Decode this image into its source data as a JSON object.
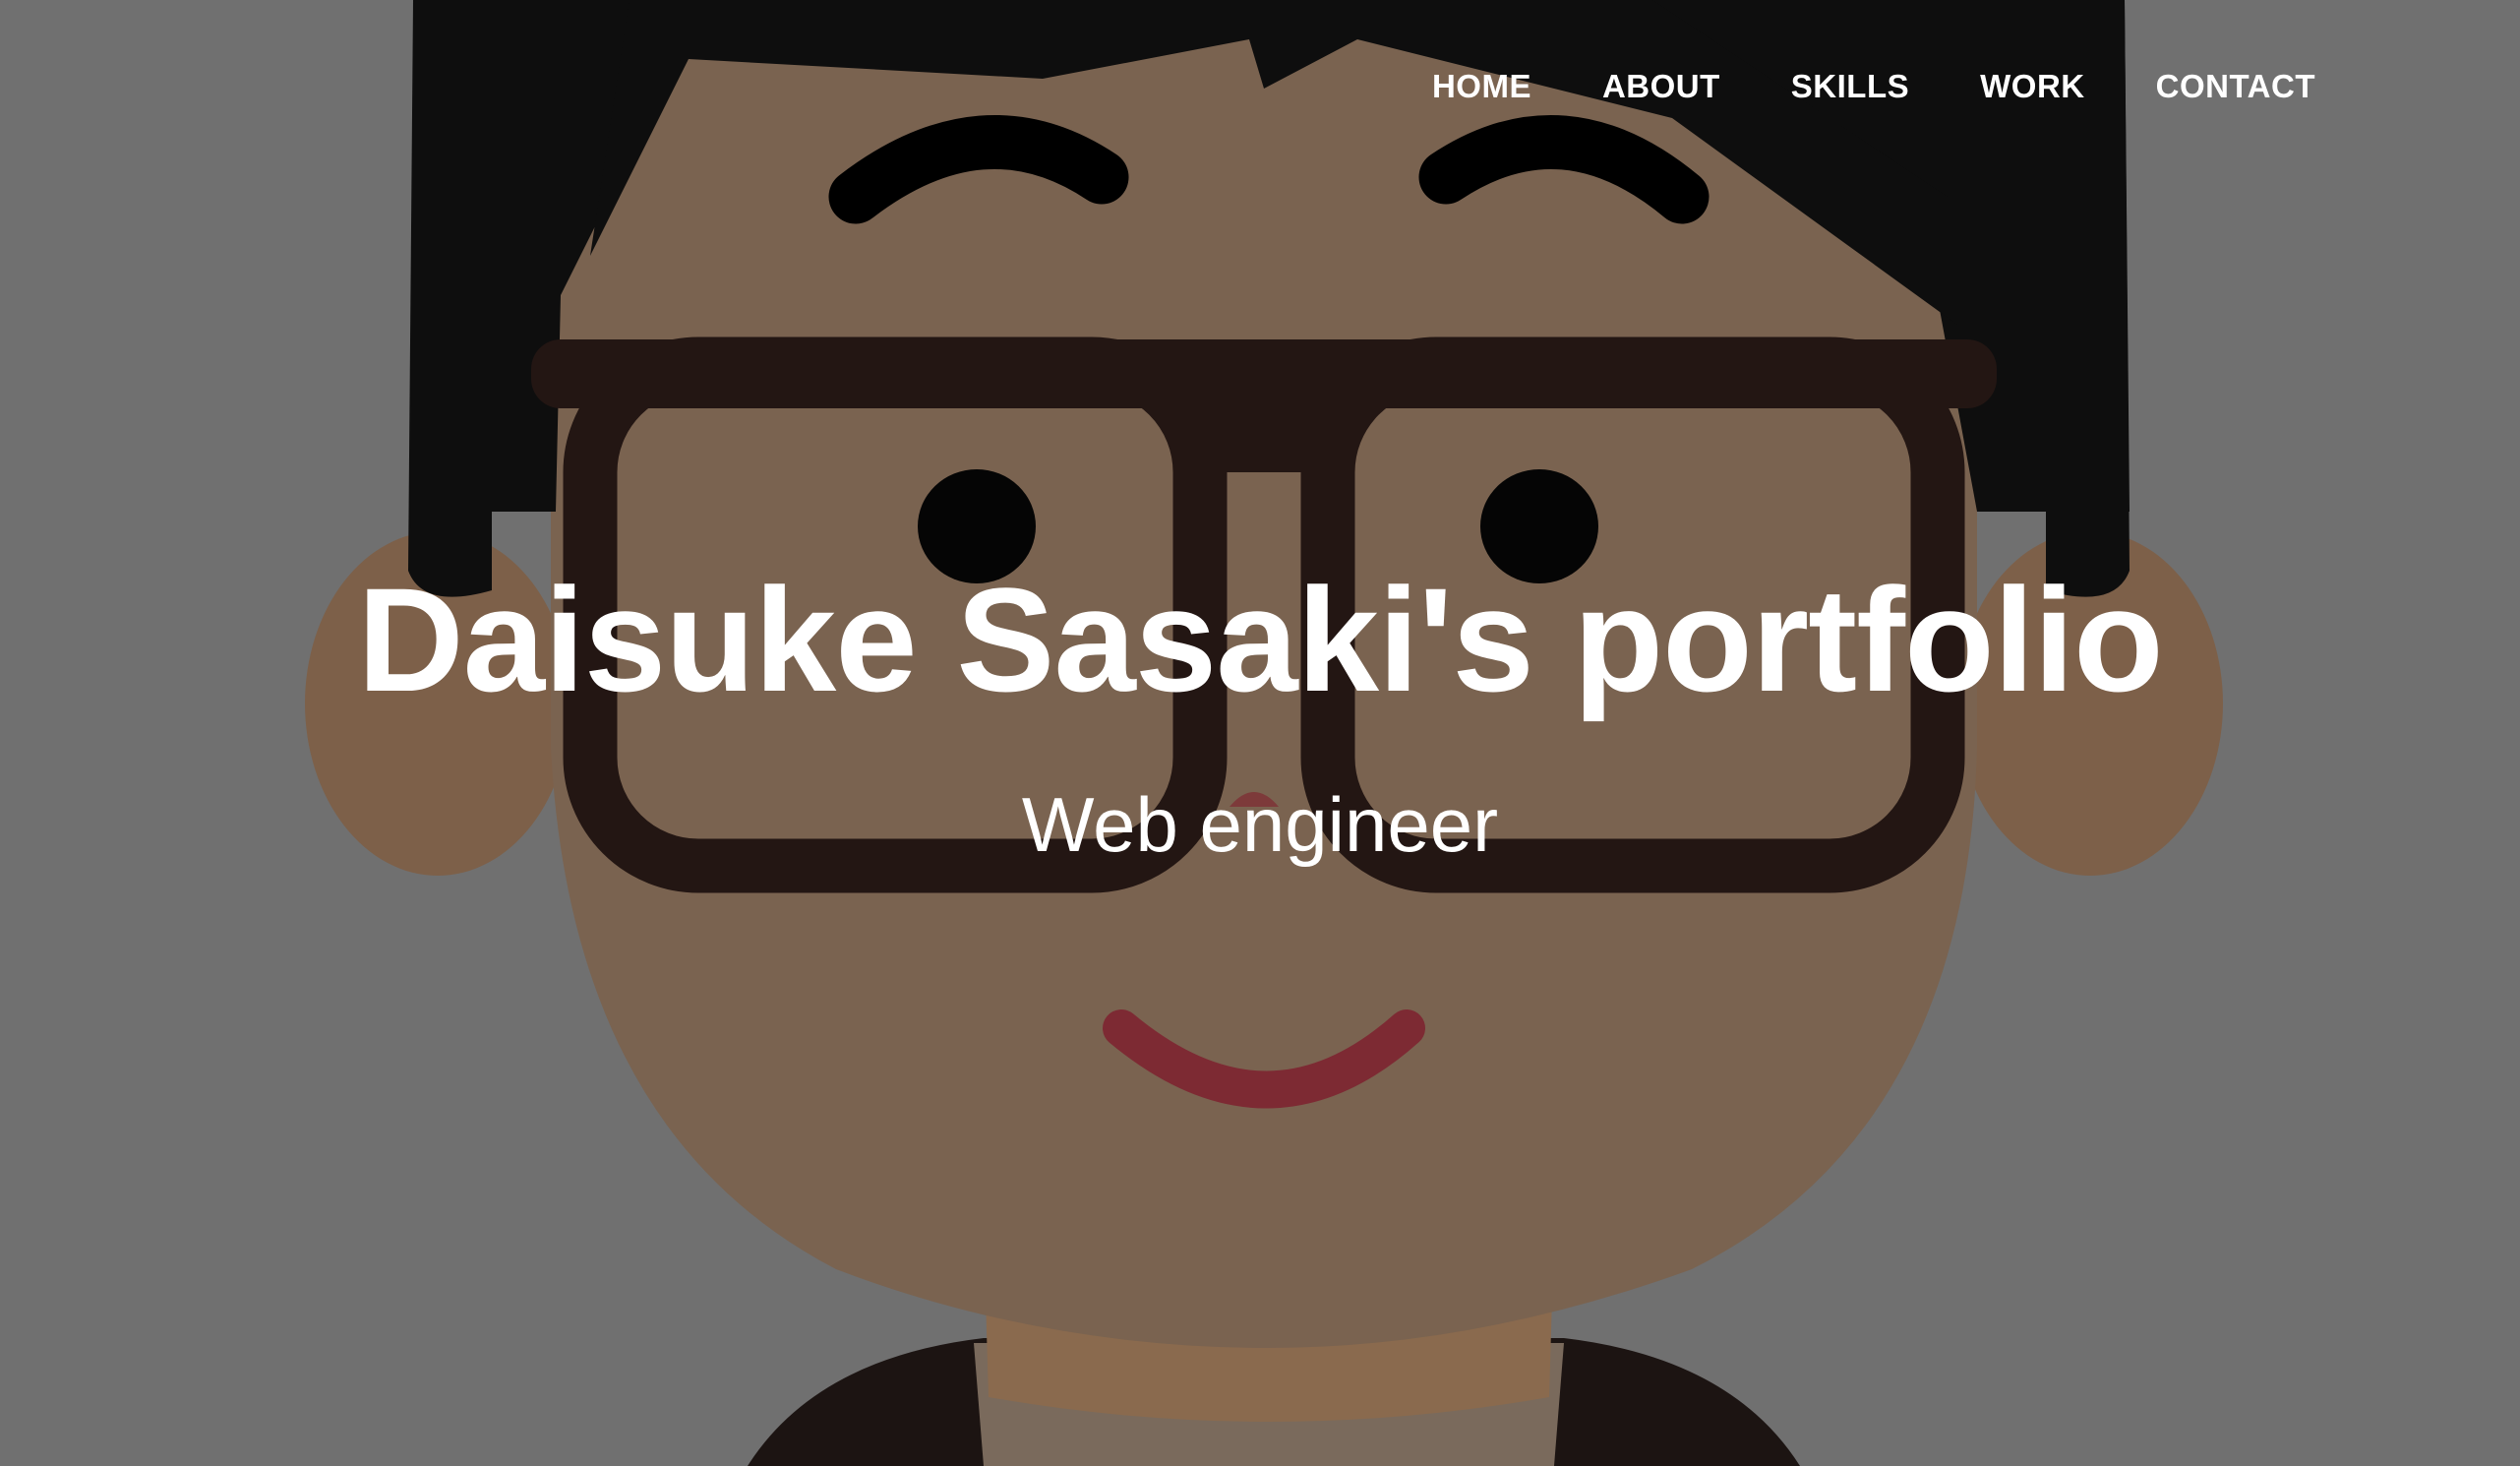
{
  "nav": {
    "items": [
      {
        "label": "HOME"
      },
      {
        "label": "ABOUT"
      },
      {
        "label": "SKILLS"
      },
      {
        "label": "WORK"
      },
      {
        "label": "CONTACT"
      }
    ]
  },
  "hero": {
    "title": "Daisuke Sasaki's portfolio",
    "subtitle": "Web engineer",
    "background_illustration": "cartoon-face-with-glasses",
    "overlay_color": "#707070"
  },
  "colors": {
    "text": "#ffffff",
    "hair": "#0d0d0d",
    "skin": "#7a6350",
    "glasses": "#231613",
    "mouth": "#7d2a33",
    "background": "#707070"
  }
}
